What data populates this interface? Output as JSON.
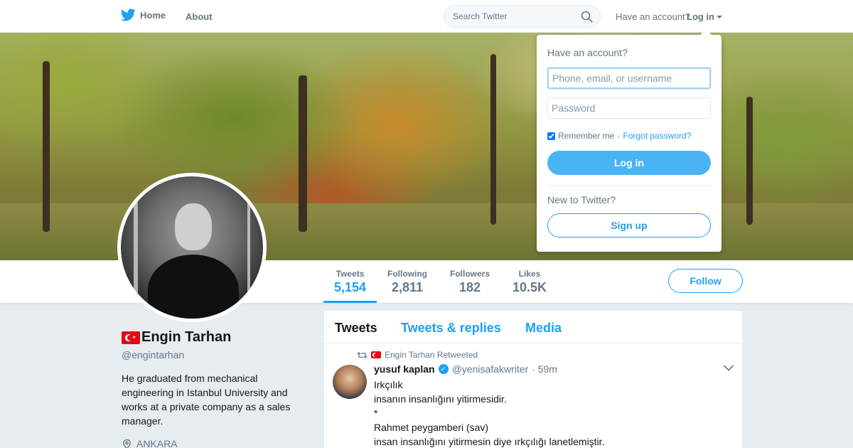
{
  "brand": {
    "accent": "#1da1f2",
    "logo_icon": "twitter-bird-icon"
  },
  "nav": {
    "home_label": "Home",
    "about_label": "About",
    "search_placeholder": "Search Twitter",
    "account_question": "Have an account?",
    "login_label": "Log in"
  },
  "login_dropdown": {
    "title": "Have an account?",
    "username_placeholder": "Phone, email, or username",
    "password_placeholder": "Password",
    "remember_label": "Remember me",
    "remember_checked": true,
    "separator": "·",
    "forgot_label": "Forgot password?",
    "login_button": "Log in",
    "new_label": "New to Twitter?",
    "signup_button": "Sign up"
  },
  "profile": {
    "name": "Engin Tarhan",
    "handle": "@engintarhan",
    "bio": "He graduated from mechanical engineering in Istanbul University and works at a private company as a sales manager.",
    "location": "ANKARA"
  },
  "stats": [
    {
      "label": "Tweets",
      "value": "5,154",
      "active": true
    },
    {
      "label": "Following",
      "value": "2,811"
    },
    {
      "label": "Followers",
      "value": "182"
    },
    {
      "label": "Likes",
      "value": "10.5K"
    }
  ],
  "follow_button": "Follow",
  "tabs": [
    "Tweets",
    "Tweets & replies",
    "Media"
  ],
  "tweet": {
    "retweet_by": "Engin Tarhan Retweeted",
    "author_name": "yusuf kaplan",
    "author_handle": "@yenisafakwriter",
    "time": "· 59m",
    "lines": [
      "Irkçılık",
      "insanın insanlığını yitirmesidir.",
      "*",
      "Rahmet peygamberi (sav)",
      "insan insanlığını yitirmesin diye ırkçılığı lanetlemiştir."
    ]
  }
}
